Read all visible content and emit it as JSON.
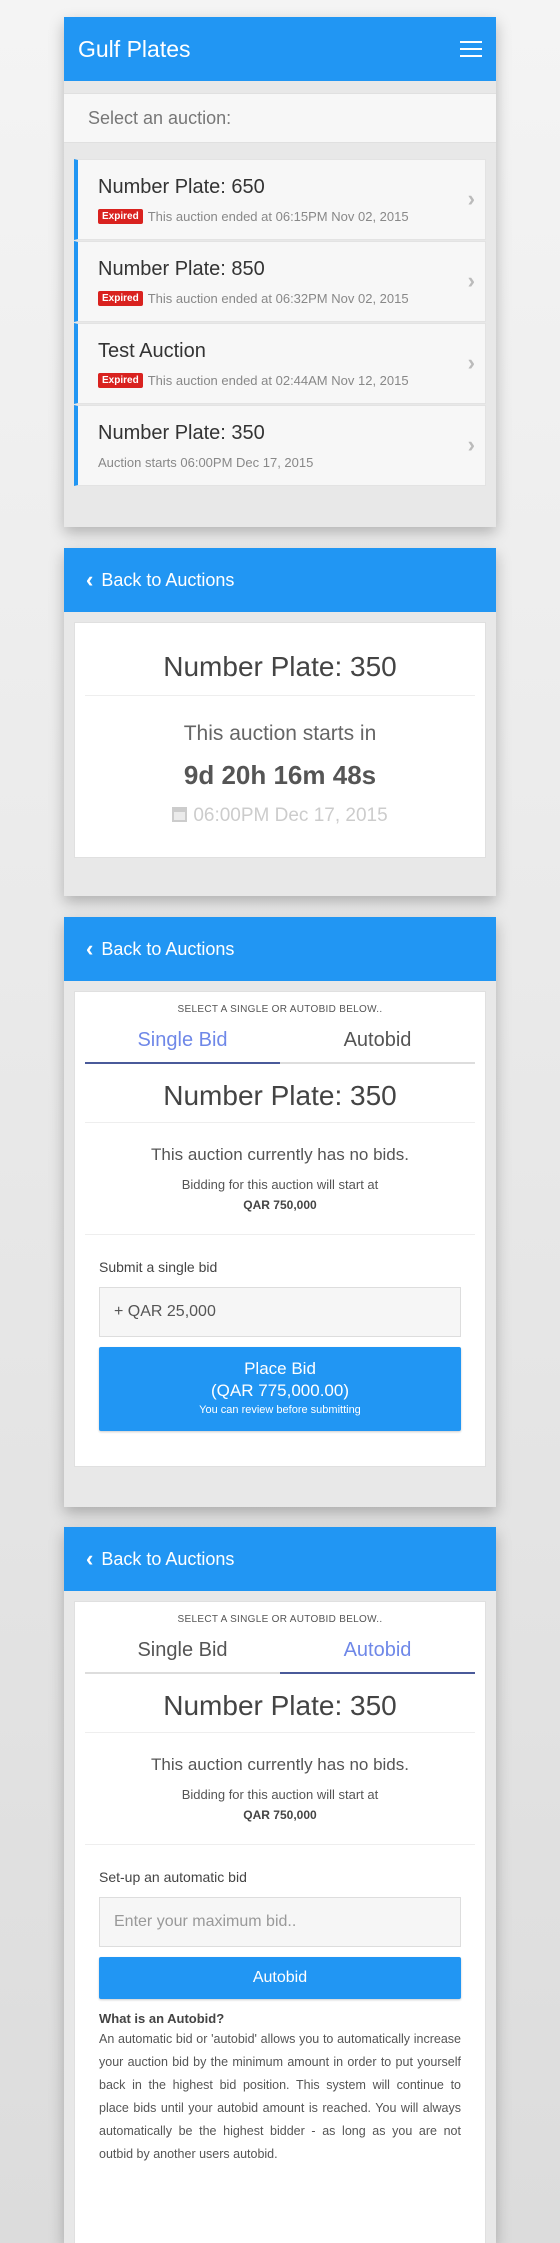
{
  "screen1": {
    "app_title": "Gulf Plates",
    "select_prompt": "Select an auction:",
    "auctions": [
      {
        "name": "Number Plate: 650",
        "badge": "Expired",
        "status": "This auction ended at 06:15PM Nov 02, 2015"
      },
      {
        "name": "Number Plate: 850",
        "badge": "Expired",
        "status": "This auction ended at 06:32PM Nov 02, 2015"
      },
      {
        "name": "Test Auction",
        "badge": "Expired",
        "status": "This auction ended at 02:44AM Nov 12, 2015"
      },
      {
        "name": "Number Plate: 350",
        "badge": "",
        "status": "Auction starts 06:00PM Dec 17, 2015"
      }
    ]
  },
  "screen2": {
    "back_label": "Back to Auctions",
    "plate_title": "Number Plate: 350",
    "starts_in_label": "This auction starts in",
    "countdown": "9d 20h 16m 48s",
    "start_date": "06:00PM Dec 17, 2015"
  },
  "screen3": {
    "back_label": "Back to Auctions",
    "select_hint": "SELECT A SINGLE OR AUTOBID BELOW..",
    "tabs": [
      "Single Bid",
      "Autobid"
    ],
    "plate_title": "Number Plate: 350",
    "no_bids": "This auction currently has no bids.",
    "bid_start_label": "Bidding for this auction will start at",
    "bid_start_amount": "QAR 750,000",
    "form_label": "Submit a single bid",
    "input_value": "+ QAR 25,000",
    "button_title": "Place Bid",
    "button_amount": "(QAR 775,000.00)",
    "button_note": "You can review before submitting"
  },
  "screen4": {
    "back_label": "Back to Auctions",
    "select_hint": "SELECT A SINGLE OR AUTOBID BELOW..",
    "tabs": [
      "Single Bid",
      "Autobid"
    ],
    "plate_title": "Number Plate: 350",
    "no_bids": "This auction currently has no bids.",
    "bid_start_label": "Bidding for this auction will start at",
    "bid_start_amount": "QAR 750,000",
    "form_label": "Set-up an automatic bid",
    "input_placeholder": "Enter your maximum bid..",
    "button_label": "Autobid",
    "explain_title": "What is an Autobid?",
    "explain_text": "An automatic bid or 'autobid' allows you to automatically increase your auction bid by the minimum amount in order to put yourself back in the highest bid position. This system will continue to place bids until your autobid amount is reached. You will always automatically be the highest bidder - as long as you are not outbid by another users autobid."
  },
  "colors": {
    "primary": "#2196f3",
    "expired": "#d9221f",
    "active_tab": "#6f88e8"
  }
}
